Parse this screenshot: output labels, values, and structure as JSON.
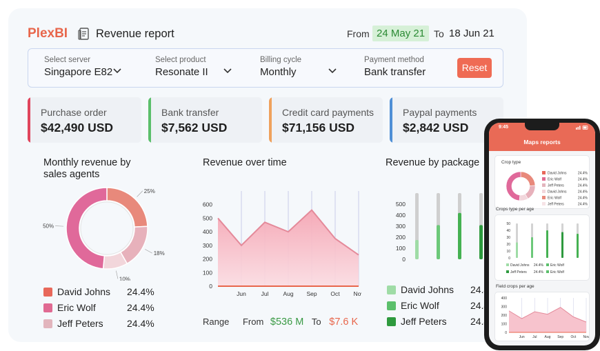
{
  "header": {
    "logo": "PlexBI",
    "title": "Revenue report",
    "from_label": "From",
    "from_date": "24 May 21",
    "to_label": "To",
    "to_date": "18 Jun 21"
  },
  "filters": {
    "server": {
      "label": "Select server",
      "value": "Singapore E82"
    },
    "product": {
      "label": "Select product",
      "value": "Resonate II"
    },
    "billing": {
      "label": "Billing cycle",
      "value": "Monthly"
    },
    "payment": {
      "label": "Payment method",
      "value": "Bank transfer"
    },
    "reset_label": "Reset"
  },
  "kpis": [
    {
      "label": "Purchase order",
      "value": "$42,490 USD",
      "color": "#e0455c"
    },
    {
      "label": "Bank transfer",
      "value": "$7,562 USD",
      "color": "#5bbf6b"
    },
    {
      "label": "Credit card payments",
      "value": "$71,156 USD",
      "color": "#efa15c"
    },
    {
      "label": "Paypal payments",
      "value": "$2,842 USD",
      "color": "#4f8fd6"
    }
  ],
  "colors": {
    "accent": "#e8664b",
    "green": "#3a9a45",
    "from_bg": "#d6f0d7"
  },
  "agents_chart": {
    "title_line1": "Monthly revenue by",
    "title_line2": "sales agents",
    "legend": [
      {
        "name": "David Johns",
        "pct": "24.4%",
        "color": "#e8685a"
      },
      {
        "name": "Eric Wolf",
        "pct": "24.4%",
        "color": "#e06a92"
      },
      {
        "name": "Jeff Peters",
        "pct": "24.4%",
        "color": "#e2b5bd"
      }
    ]
  },
  "range": {
    "label": "Range",
    "from_label": "From",
    "from_value": "$536 M",
    "to_label": "To",
    "to_value": "$7.6 K"
  },
  "package_chart": {
    "title": "Revenue by package",
    "legend": [
      {
        "name": "David Johns",
        "pct": "24.4%",
        "color": "#9fdca6"
      },
      {
        "name": "Eric Wolf",
        "pct": "24.4%",
        "color": "#5bbf6b"
      },
      {
        "name": "Jeff Peters",
        "pct": "24.4%",
        "color": "#2e9a3e"
      }
    ]
  },
  "chart_data": [
    {
      "type": "pie",
      "title": "Monthly revenue by sales agents",
      "slices": [
        {
          "label": "25%",
          "value": 25,
          "color": "#e8897b"
        },
        {
          "label": "18%",
          "value": 18,
          "color": "#e7b1bb"
        },
        {
          "label": "10%",
          "value": 10,
          "color": "#f2d6db"
        },
        {
          "label": "50%",
          "value": 50,
          "color": "#e0699a"
        }
      ]
    },
    {
      "type": "area",
      "title": "Revenue over time",
      "x_ticks": [
        "Jun",
        "Jul",
        "Aug",
        "Sep",
        "Oct",
        "Nov"
      ],
      "y_ticks": [
        0,
        100,
        200,
        300,
        400,
        500,
        600
      ],
      "ylim": [
        0,
        700
      ],
      "points": [
        {
          "x": 0,
          "y": 500
        },
        {
          "x": 1,
          "y": 300
        },
        {
          "x": 2,
          "y": 470
        },
        {
          "x": 3,
          "y": 400
        },
        {
          "x": 4,
          "y": 560
        },
        {
          "x": 5,
          "y": 350
        },
        {
          "x": 6,
          "y": 230
        }
      ]
    },
    {
      "type": "bar",
      "title": "Revenue by package",
      "y_ticks": [
        0,
        100,
        200,
        300,
        400,
        500
      ],
      "ylim": [
        0,
        600
      ],
      "bars": [
        {
          "total": 600,
          "value": 175,
          "color": "#9fdca6"
        },
        {
          "total": 600,
          "value": 310,
          "color": "#6cc879"
        },
        {
          "total": 600,
          "value": 420,
          "color": "#45b152"
        },
        {
          "total": 600,
          "value": 310,
          "color": "#2e9a3e"
        }
      ]
    }
  ],
  "phone": {
    "time": "9:45",
    "app_title": "Maps reports",
    "crop_type": {
      "title": "Crop type",
      "legend": [
        {
          "name": "David Johns",
          "pct": "24.4%",
          "color": "#e8685a"
        },
        {
          "name": "Eric Wolf",
          "pct": "24.4%",
          "color": "#e06a92"
        },
        {
          "name": "Jeff Peters",
          "pct": "24.4%",
          "color": "#e2b5bd"
        },
        {
          "name": "David Johns",
          "pct": "24.4%",
          "color": "#f2d6db"
        },
        {
          "name": "Eric Wolf",
          "pct": "24.4%",
          "color": "#e8897b"
        },
        {
          "name": "Jeff Peters",
          "pct": "24.4%",
          "color": "#f6e3e6"
        }
      ]
    },
    "crops_per_age": {
      "title": "Crops type per age",
      "y_ticks": [
        0,
        10,
        20,
        30,
        40,
        50
      ],
      "legend": [
        {
          "name": "David Johns",
          "pct": "24.4%",
          "color": "#9fdca6"
        },
        {
          "name": "Eric Wolf",
          "pct": "",
          "color": "#5bbf6b"
        },
        {
          "name": "Jeff Peters",
          "pct": "24.4%",
          "color": "#2e9a3e"
        },
        {
          "name": "Eric Wolf",
          "pct": "",
          "color": "#5bbf6b"
        }
      ]
    },
    "field_crops": {
      "title": "Field crops per age",
      "x_ticks": [
        "Jun",
        "Jul",
        "Aug",
        "Sep",
        "Oct",
        "Nov"
      ],
      "y_ticks": [
        0,
        100,
        200,
        300,
        400
      ],
      "points": [
        {
          "x": 0,
          "y": 250
        },
        {
          "x": 1,
          "y": 160
        },
        {
          "x": 2,
          "y": 240
        },
        {
          "x": 3,
          "y": 210
        },
        {
          "x": 4,
          "y": 290
        },
        {
          "x": 5,
          "y": 180
        },
        {
          "x": 6,
          "y": 120
        }
      ]
    }
  }
}
